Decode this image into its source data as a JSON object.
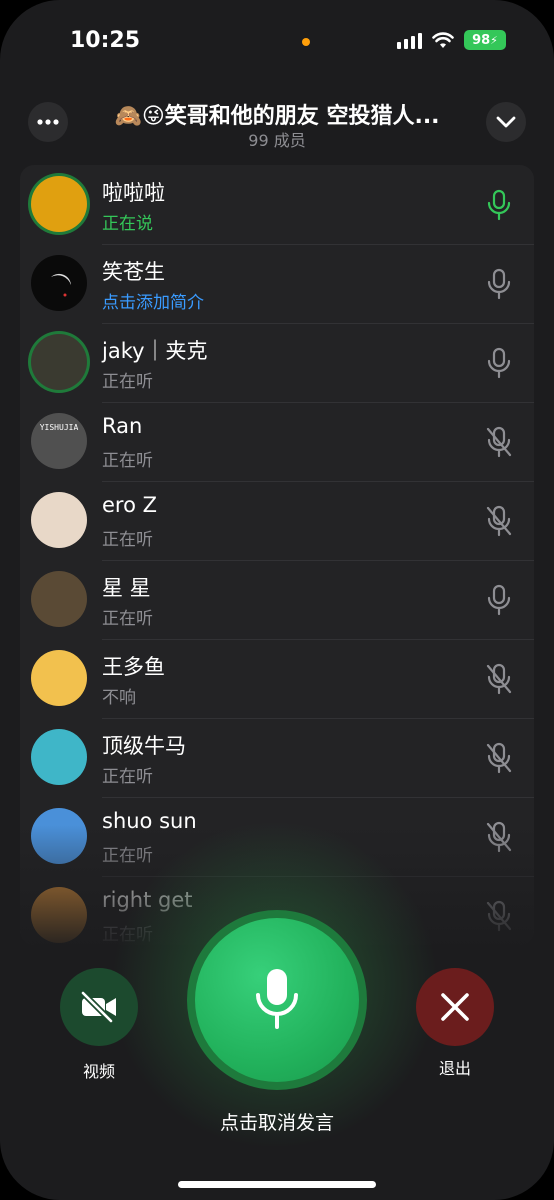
{
  "status_bar": {
    "time": "10:25",
    "battery": "98"
  },
  "header": {
    "title": "🙈😜笑哥和他的朋友 空投猎人...",
    "subtitle": "99 成员"
  },
  "participants": [
    {
      "name": "啦啦啦",
      "status": "正在说",
      "mic": "on",
      "avatar_bg": "#e0a010"
    },
    {
      "name": "笑苍生",
      "status": "点击添加简介",
      "mic": "open",
      "avatar_bg": "#0a0a0a"
    },
    {
      "name": "jaky｜夹克",
      "status": "正在听",
      "mic": "open",
      "avatar_bg": "#3a3a30"
    },
    {
      "name": "Ran",
      "status": "正在听",
      "mic": "muted",
      "avatar_bg": "#505050",
      "avatar_text": "YISHUJIA"
    },
    {
      "name": "ero Z",
      "status": "正在听",
      "mic": "muted",
      "avatar_bg": "#e8d8c8"
    },
    {
      "name": "星 星",
      "status": "正在听",
      "mic": "open",
      "avatar_bg": "#5a4a35"
    },
    {
      "name": "王多鱼",
      "status": "不响",
      "mic": "muted",
      "avatar_bg": "#f2c14e"
    },
    {
      "name": "顶级牛马",
      "status": "正在听",
      "mic": "muted",
      "avatar_bg": "#3fb6c8"
    },
    {
      "name": "shuo sun",
      "status": "正在听",
      "mic": "muted",
      "avatar_bg": "#4a90d9"
    },
    {
      "name": "right get",
      "status": "正在听",
      "mic": "muted",
      "avatar_bg": "#d08a3a"
    }
  ],
  "controls": {
    "video_label": "视频",
    "leave_label": "退出",
    "mic_label": "点击取消发言"
  },
  "colors": {
    "speaking": "#34c759",
    "link": "#3a9bff",
    "leave": "#6b1d1d",
    "video": "#1c4a2e"
  },
  "icons": [
    "more-icon",
    "chevron-down-icon",
    "mic-icon",
    "mic-muted-icon",
    "video-off-icon",
    "close-icon"
  ]
}
